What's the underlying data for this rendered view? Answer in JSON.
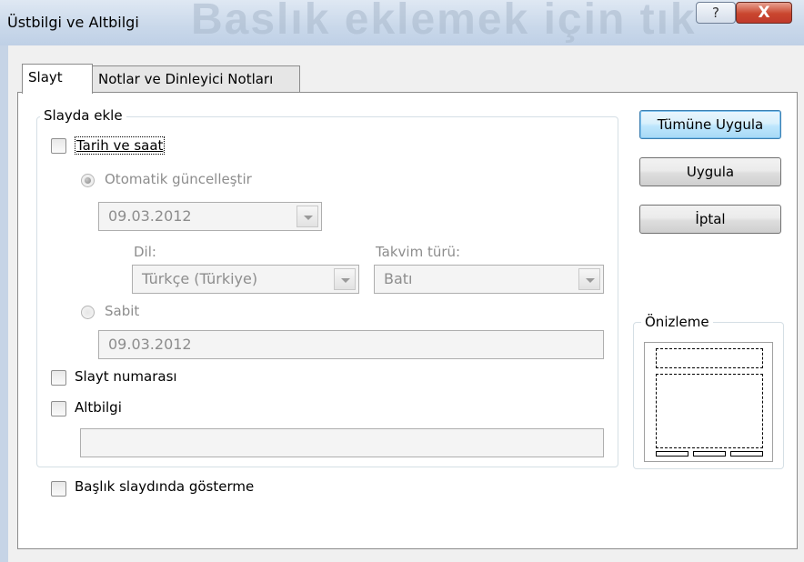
{
  "window": {
    "title": "Üstbilgi ve Altbilgi",
    "background_text": "Baslık eklemek için tık",
    "help_label": "?",
    "close_label": "X"
  },
  "tabs": [
    {
      "label": "Slayt",
      "active": true
    },
    {
      "label": "Notlar ve Dinleyici Notları",
      "active": false
    }
  ],
  "slide_group": {
    "legend": "Slayda ekle",
    "date_time": {
      "label": "Tarih ve saat",
      "checked": false
    },
    "auto_update": {
      "label": "Otomatik güncelleştir",
      "selected": true,
      "enabled": false
    },
    "auto_date_value": "09.03.2012",
    "language_label": "Dil:",
    "language_value": "Türkçe (Türkiye)",
    "calendar_label": "Takvim türü:",
    "calendar_value": "Batı",
    "fixed": {
      "label": "Sabit",
      "selected": false,
      "enabled": false
    },
    "fixed_value": "09.03.2012",
    "slide_number": {
      "label": "Slayt numarası",
      "checked": false
    },
    "footer": {
      "label": "Altbilgi",
      "checked": false
    },
    "footer_value": ""
  },
  "dont_show_on_title": {
    "label": "Başlık slaydında gösterme",
    "checked": false
  },
  "buttons": {
    "apply_all": "Tümüne Uygula",
    "apply": "Uygula",
    "cancel": "İptal"
  },
  "preview": {
    "legend": "Önizleme"
  },
  "colors": {
    "title_gradient": "#c9d8ea",
    "close_red": "#c0392b",
    "default_button_border": "#3c7fb1",
    "disabled_text": "#8d8d8d"
  }
}
